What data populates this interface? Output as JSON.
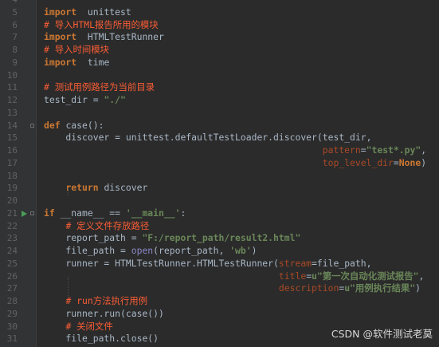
{
  "editor": {
    "lines": [
      {
        "n": "4",
        "t": []
      },
      {
        "n": "5",
        "t": [
          [
            "kw",
            "import"
          ],
          [
            "",
            "  unittest"
          ]
        ]
      },
      {
        "n": "6",
        "t": [
          [
            "cm",
            "# 导入HTML报告所用的模块"
          ]
        ]
      },
      {
        "n": "7",
        "t": [
          [
            "kw",
            "import"
          ],
          [
            "",
            "  HTMLTestRunner"
          ]
        ]
      },
      {
        "n": "8",
        "t": [
          [
            "cm",
            "# 导入时间模块"
          ]
        ]
      },
      {
        "n": "9",
        "t": [
          [
            "kw",
            "import"
          ],
          [
            "",
            "  time"
          ]
        ]
      },
      {
        "n": "10",
        "t": []
      },
      {
        "n": "11",
        "t": [
          [
            "cm",
            "# 测试用例路径为当前目录"
          ]
        ]
      },
      {
        "n": "12",
        "t": [
          [
            "",
            "test_dir = "
          ],
          [
            "st",
            "\"./\""
          ]
        ]
      },
      {
        "n": "13",
        "t": []
      },
      {
        "n": "14",
        "t": [
          [
            "kw",
            "def "
          ],
          [
            "",
            "case():"
          ]
        ]
      },
      {
        "n": "15",
        "t": [
          [
            "",
            "    discover = unittest.defaultTestLoader.discover(test_dir,"
          ]
        ]
      },
      {
        "n": "16",
        "t": [
          [
            "",
            "                                                   "
          ],
          [
            "pr",
            "pattern"
          ],
          [
            "",
            "="
          ],
          [
            "st",
            "\"test*.py\""
          ],
          [
            "",
            ","
          ]
        ]
      },
      {
        "n": "17",
        "t": [
          [
            "",
            "                                                   "
          ],
          [
            "pr",
            "top_level_dir"
          ],
          [
            "",
            "="
          ],
          [
            "kw",
            "None"
          ],
          [
            "",
            ")"
          ]
        ]
      },
      {
        "n": "18",
        "t": []
      },
      {
        "n": "19",
        "t": [
          [
            "",
            "    "
          ],
          [
            "kw",
            "return"
          ],
          [
            "",
            " discover"
          ]
        ]
      },
      {
        "n": "20",
        "t": []
      },
      {
        "n": "21",
        "t": [
          [
            "kw",
            "if"
          ],
          [
            "",
            " __name__ == "
          ],
          [
            "st",
            "'__main__'"
          ],
          [
            "",
            ":"
          ]
        ]
      },
      {
        "n": "22",
        "t": [
          [
            "",
            "    "
          ],
          [
            "cm",
            "# 定义文件存放路径"
          ]
        ]
      },
      {
        "n": "23",
        "t": [
          [
            "",
            "    report_path = "
          ],
          [
            "st",
            "\"F:/report_path/result2.html\""
          ]
        ]
      },
      {
        "n": "24",
        "t": [
          [
            "",
            "    file_path = "
          ],
          [
            "bi",
            "open"
          ],
          [
            "",
            "(report_path, "
          ],
          [
            "st",
            "'wb'"
          ],
          [
            "",
            ")"
          ]
        ]
      },
      {
        "n": "25",
        "t": [
          [
            "",
            "    runner = HTMLTestRunner.HTMLTestRunner("
          ],
          [
            "pr",
            "stream"
          ],
          [
            "",
            "=file_path,"
          ]
        ]
      },
      {
        "n": "26",
        "t": [
          [
            "",
            "                                           "
          ],
          [
            "pr",
            "title"
          ],
          [
            "",
            "="
          ],
          [
            "st",
            "u\"第一次自动化测试报告\""
          ],
          [
            "",
            ","
          ]
        ]
      },
      {
        "n": "27",
        "t": [
          [
            "",
            "                                           "
          ],
          [
            "pr",
            "description"
          ],
          [
            "",
            "="
          ],
          [
            "st",
            "u\"用例执行结果\""
          ],
          [
            "",
            ")"
          ]
        ]
      },
      {
        "n": "28",
        "t": [
          [
            "",
            "    "
          ],
          [
            "cm",
            "# run方法执行用例"
          ]
        ]
      },
      {
        "n": "29",
        "t": [
          [
            "",
            "    runner.run(case())"
          ]
        ]
      },
      {
        "n": "30",
        "t": [
          [
            "",
            "    "
          ],
          [
            "cm",
            "# 关闭文件"
          ]
        ]
      },
      {
        "n": "31",
        "t": [
          [
            "",
            "    file_path.close()"
          ]
        ]
      }
    ],
    "run_marker_line": "21",
    "fold_marker_lines": [
      "14",
      "21"
    ]
  },
  "watermark": "CSDN @软件测试老莫",
  "colors": {
    "background": "#2b2b2b",
    "gutter": "#313335",
    "keyword": "#cc7832",
    "comment": "#fa5d35",
    "string": "#6a8759",
    "param": "#aa4926",
    "builtin": "#8888c6",
    "default_text": "#a9b7c6",
    "line_number": "#606366",
    "run_icon": "#499c54"
  },
  "icons": {
    "run": "run-gutter-icon",
    "fold": "fold-marker-icon"
  }
}
